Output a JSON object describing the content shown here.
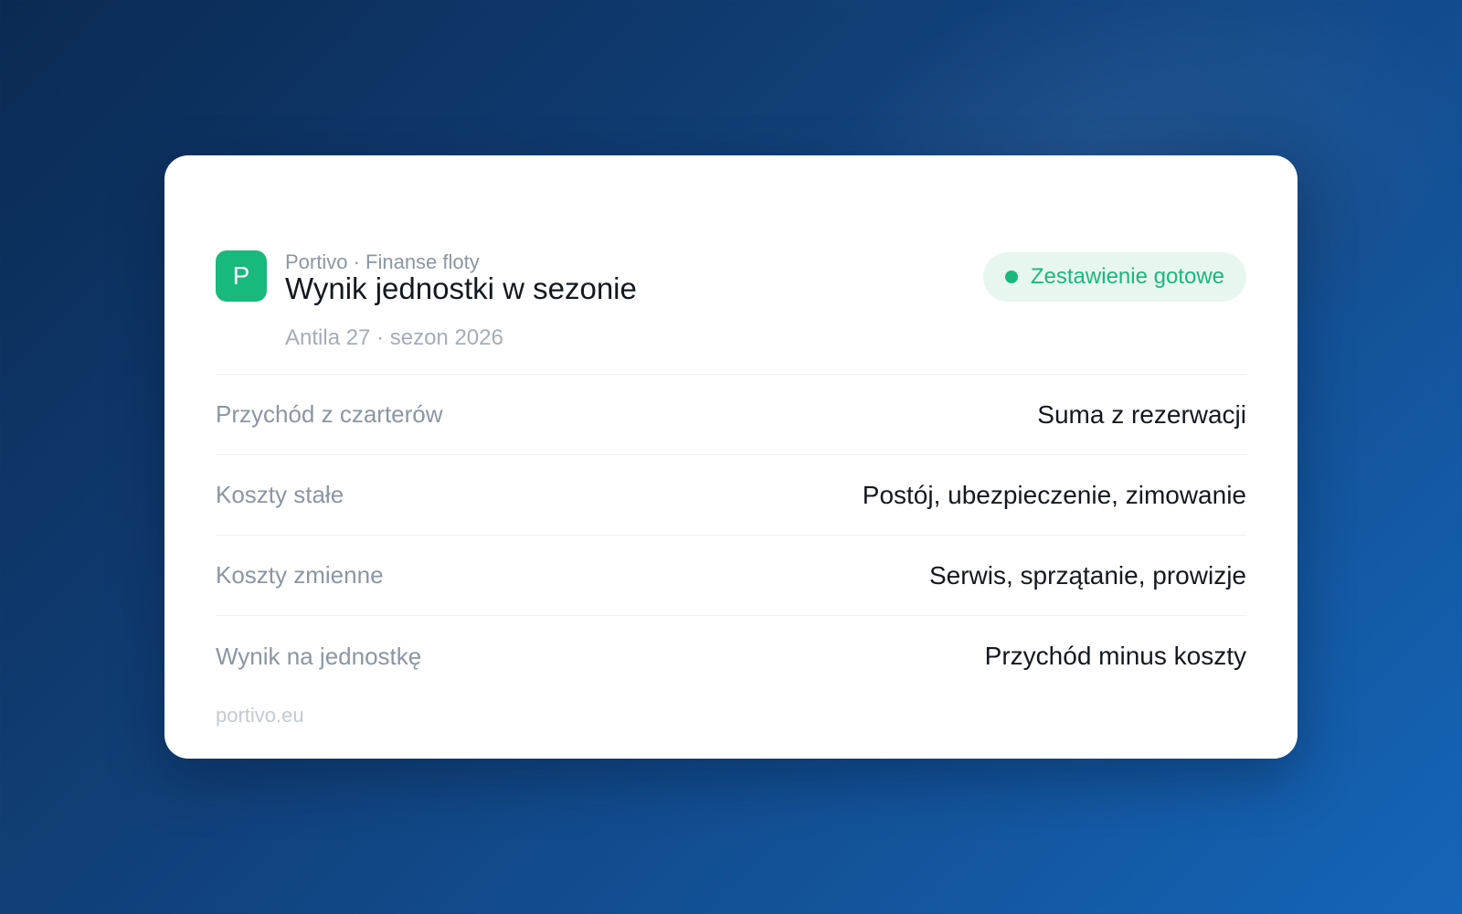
{
  "header": {
    "logo_letter": "P",
    "eyebrow": "Portivo · Finanse floty",
    "title": "Wynik jednostki w sezonie",
    "subtitle": "Antila 27 · sezon 2026",
    "status": {
      "label": "Zestawienie gotowe",
      "color": "#19b87d"
    }
  },
  "rows": [
    {
      "label": "Przychód z czarterów",
      "value": "Suma z rezerwacji"
    },
    {
      "label": "Koszty stałe",
      "value": "Postój, ubezpieczenie, zimowanie"
    },
    {
      "label": "Koszty zmienne",
      "value": "Serwis, sprzątanie, prowizje"
    },
    {
      "label": "Wynik na jednostkę",
      "value": "Przychód minus koszty"
    }
  ],
  "footer": {
    "domain": "portivo.eu"
  },
  "colors": {
    "brand": "#19b87d",
    "background_start": "#0b2a52",
    "background_end": "#1565b8"
  }
}
